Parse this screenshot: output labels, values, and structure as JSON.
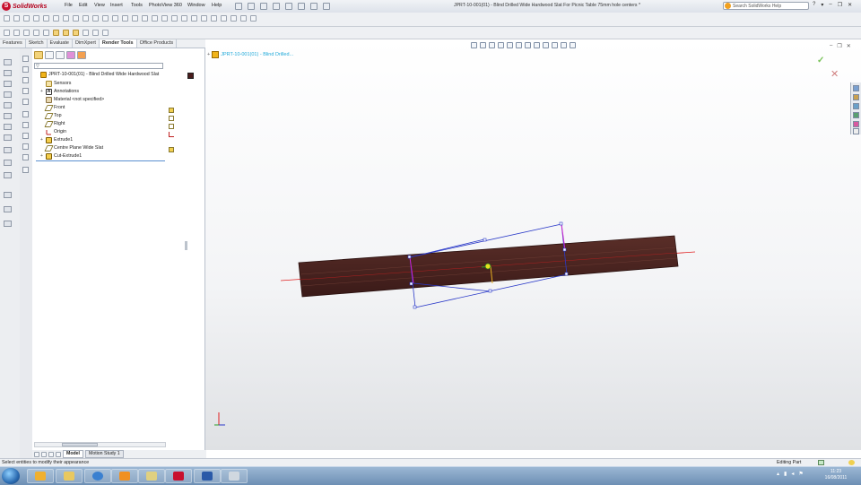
{
  "app": {
    "logo_text": "SolidWorks",
    "document_title": "JPRT-10-001(01) - Blind Drilled Wide Hardwood Slat For Picnic Table 75mm hole centers *"
  },
  "menu": [
    "File",
    "Edit",
    "View",
    "Insert",
    "Tools",
    "PhotoView 360",
    "Window",
    "Help"
  ],
  "search": {
    "placeholder": "Search SolidWorks Help"
  },
  "window_controls": [
    "?",
    "▾",
    "–",
    "❐",
    "✕"
  ],
  "command_tabs": [
    {
      "label": "Features",
      "active": false
    },
    {
      "label": "Sketch",
      "active": false
    },
    {
      "label": "Evaluate",
      "active": false
    },
    {
      "label": "DimXpert",
      "active": false
    },
    {
      "label": "Render Tools",
      "active": true
    },
    {
      "label": "Office Products",
      "active": false
    }
  ],
  "feature_tree": {
    "root": "JPRT-10-001(01) - Blind Drilled Wide Hardwood Slat",
    "items": [
      {
        "label": "Sensors",
        "icon": "sensor-icon",
        "expandable": false
      },
      {
        "label": "Annotations",
        "icon": "annotation-icon",
        "expandable": true
      },
      {
        "label": "Material <not specified>",
        "icon": "material-icon",
        "expandable": false
      },
      {
        "label": "Front",
        "icon": "plane-icon",
        "expandable": false
      },
      {
        "label": "Top",
        "icon": "plane-icon",
        "expandable": false
      },
      {
        "label": "Right",
        "icon": "plane-icon",
        "expandable": false
      },
      {
        "label": "Origin",
        "icon": "origin-icon",
        "expandable": false
      },
      {
        "label": "Extrude1",
        "icon": "extrude-icon",
        "expandable": true
      },
      {
        "label": "Centre Plane Wide Slat",
        "icon": "plane-icon",
        "expandable": false
      },
      {
        "label": "Cut-Extrude1",
        "icon": "cut-extrude-icon",
        "expandable": true
      }
    ]
  },
  "tree_flyout": {
    "label": "JPRT-10-001(01) - Blind Drilled..."
  },
  "bottom_tabs": [
    {
      "label": "Model",
      "active": true
    },
    {
      "label": "Motion Study 1",
      "active": false
    }
  ],
  "status": {
    "message": "Select entities to modify their appearance",
    "mode": "Editing Part"
  },
  "taskbar": {
    "time": "11:23",
    "date": "16/08/2011"
  },
  "colors": {
    "wood": "#4a2420",
    "sketch_blue": "#2a39c8",
    "sketch_magenta": "#cc22cc",
    "axis_red": "#e02020",
    "accent_blue": "#1ea8d8"
  }
}
